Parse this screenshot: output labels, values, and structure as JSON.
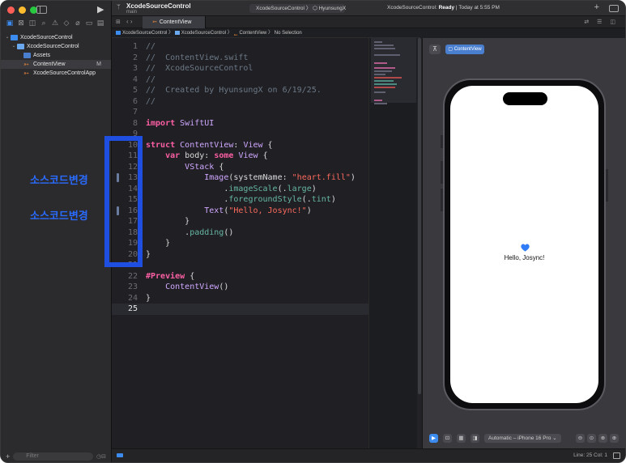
{
  "app": {
    "project_title": "XcodeSourceControl",
    "branch": "main",
    "scheme": "XcodeSourceControl 〉 ⬡ HyunsungX",
    "status_prefix": "XcodeSourceControl: ",
    "status_bold": "Ready",
    "status_suffix": " | Today at 5:55 PM"
  },
  "navigator": {
    "items": [
      {
        "label": "XcodeSourceControl",
        "icon": "project-icon",
        "level": 0
      },
      {
        "label": "XcodeSourceControl",
        "icon": "folder-icon",
        "level": 1
      },
      {
        "label": "Assets",
        "icon": "assets-icon",
        "level": 2
      },
      {
        "label": "ContentView",
        "icon": "swift-file-icon",
        "level": 2,
        "badge": "M"
      },
      {
        "label": "XcodeSourceControlApp",
        "icon": "swift-file-icon",
        "level": 2
      }
    ],
    "filter_placeholder": "Filter"
  },
  "tab": {
    "label": "ContentView"
  },
  "breadcrumb": {
    "project": "XcodeSourceControl",
    "folder": "XcodeSourceControl",
    "file": "ContentView",
    "selection": "No Selection"
  },
  "editor": {
    "lines": [
      {
        "n": "1",
        "text": "//"
      },
      {
        "n": "2",
        "text": "//  ContentView.swift"
      },
      {
        "n": "3",
        "text": "//  XcodeSourceControl"
      },
      {
        "n": "4",
        "text": "//"
      },
      {
        "n": "5",
        "text": "//  Created by HyunsungX on 6/19/25."
      },
      {
        "n": "6",
        "text": "//"
      },
      {
        "n": "7",
        "text": ""
      },
      {
        "n": "8",
        "text": "import SwiftUI"
      },
      {
        "n": "9",
        "text": ""
      },
      {
        "n": "10",
        "text": "struct ContentView: View {"
      },
      {
        "n": "11",
        "text": "    var body: some View {"
      },
      {
        "n": "12",
        "text": "        VStack {"
      },
      {
        "n": "13",
        "text": "            Image(systemName: \"heart.fill\")"
      },
      {
        "n": "14",
        "text": "                .imageScale(.large)"
      },
      {
        "n": "15",
        "text": "                .foregroundStyle(.tint)"
      },
      {
        "n": "16",
        "text": "            Text(\"Hello, Josync!\")"
      },
      {
        "n": "17",
        "text": "        }"
      },
      {
        "n": "18",
        "text": "        .padding()"
      },
      {
        "n": "19",
        "text": "    }"
      },
      {
        "n": "20",
        "text": "}"
      },
      {
        "n": "21",
        "text": ""
      },
      {
        "n": "22",
        "text": "#Preview {"
      },
      {
        "n": "23",
        "text": "    ContentView()"
      },
      {
        "n": "24",
        "text": "}"
      },
      {
        "n": "25",
        "text": ""
      }
    ],
    "changed_lines": [
      13,
      16
    ],
    "current_line": 25
  },
  "annotations": {
    "label_1": "소스코드변경",
    "label_2": "소스코드변경"
  },
  "canvas": {
    "preview_chip": "ContentView",
    "preview_text": "Hello, Josync!",
    "device": "Automatic – iPhone 16 Pro ⌄",
    "accent_color": "#2f7cf6"
  },
  "statusbar": {
    "position": "Line: 25  Col: 1"
  },
  "colors": {
    "annotation_blue": "#1f4fe0",
    "keyword": "#fc5fa3",
    "string": "#fc6a5d",
    "comment": "#6c7986"
  }
}
